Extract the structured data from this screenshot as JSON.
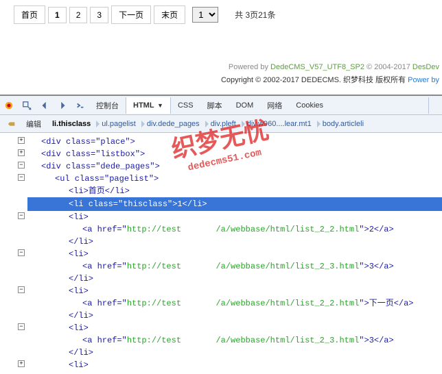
{
  "pagination": {
    "first": "首页",
    "pages": [
      "1",
      "2",
      "3"
    ],
    "active_index": 0,
    "next": "下一页",
    "last": "末页",
    "select_value": "1",
    "info": "共 3页21条"
  },
  "footer": {
    "line1_prefix": "Powered by ",
    "line1_product": "DedeCMS_V57_UTF8_SP2",
    "line1_copyright": " © 2004-2017 ",
    "line1_company": "DesDev ",
    "line2_prefix": "Copyright © 2002-2017 DEDECMS. 织梦科技 版权所有 ",
    "line2_link": "Power by "
  },
  "devtools": {
    "tabs": [
      "控制台",
      "HTML",
      "CSS",
      "脚本",
      "DOM",
      "网络",
      "Cookies"
    ],
    "active_tab_index": 1,
    "breadcrumb_edit": "编辑",
    "breadcrumb": [
      "li.thisclass",
      "ul.pagelist",
      "div.dede_pages",
      "div.pleft",
      "div.w960....lear.mt1",
      "body.articleli"
    ],
    "source": {
      "l1": "<div class=\"place\">",
      "l2": "<div class=\"listbox\">",
      "l3": "<div class=\"dede_pages\">",
      "l4": "<ul class=\"pagelist\">",
      "l5": "<li>首页</li>",
      "l6": "<li class=\"thisclass\">1</li>",
      "l7": "<li>",
      "l8_pre": "<a href=\"",
      "l8_url_a": "http://test",
      "l8_url_b": "/a/webbase/html/list_2_2.html",
      "l8_post": "\">2</a>",
      "l9": "</li>",
      "l10": "<li>",
      "l11_pre": "<a href=\"",
      "l11_url_a": "http://test",
      "l11_url_b": "/a/webbase/html/list_2_3.html",
      "l11_post": "\">3</a>",
      "l12": "</li>",
      "l13": "<li>",
      "l14_pre": "<a href=\"",
      "l14_url_a": "http://test",
      "l14_url_b": "/a/webbase/html/list_2_2.html",
      "l14_post": "\">下一页</a>",
      "l15": "</li>",
      "l16": "<li>",
      "l17_pre": "<a href=\"",
      "l17_url_a": "http://test",
      "l17_url_b": "/a/webbase/html/list_2_3.html",
      "l17_post": "\">3</a>",
      "l18": "</li>",
      "l19": "<li>"
    }
  },
  "watermark": {
    "main": "织梦无忧",
    "sub": "dedecms51.com"
  }
}
